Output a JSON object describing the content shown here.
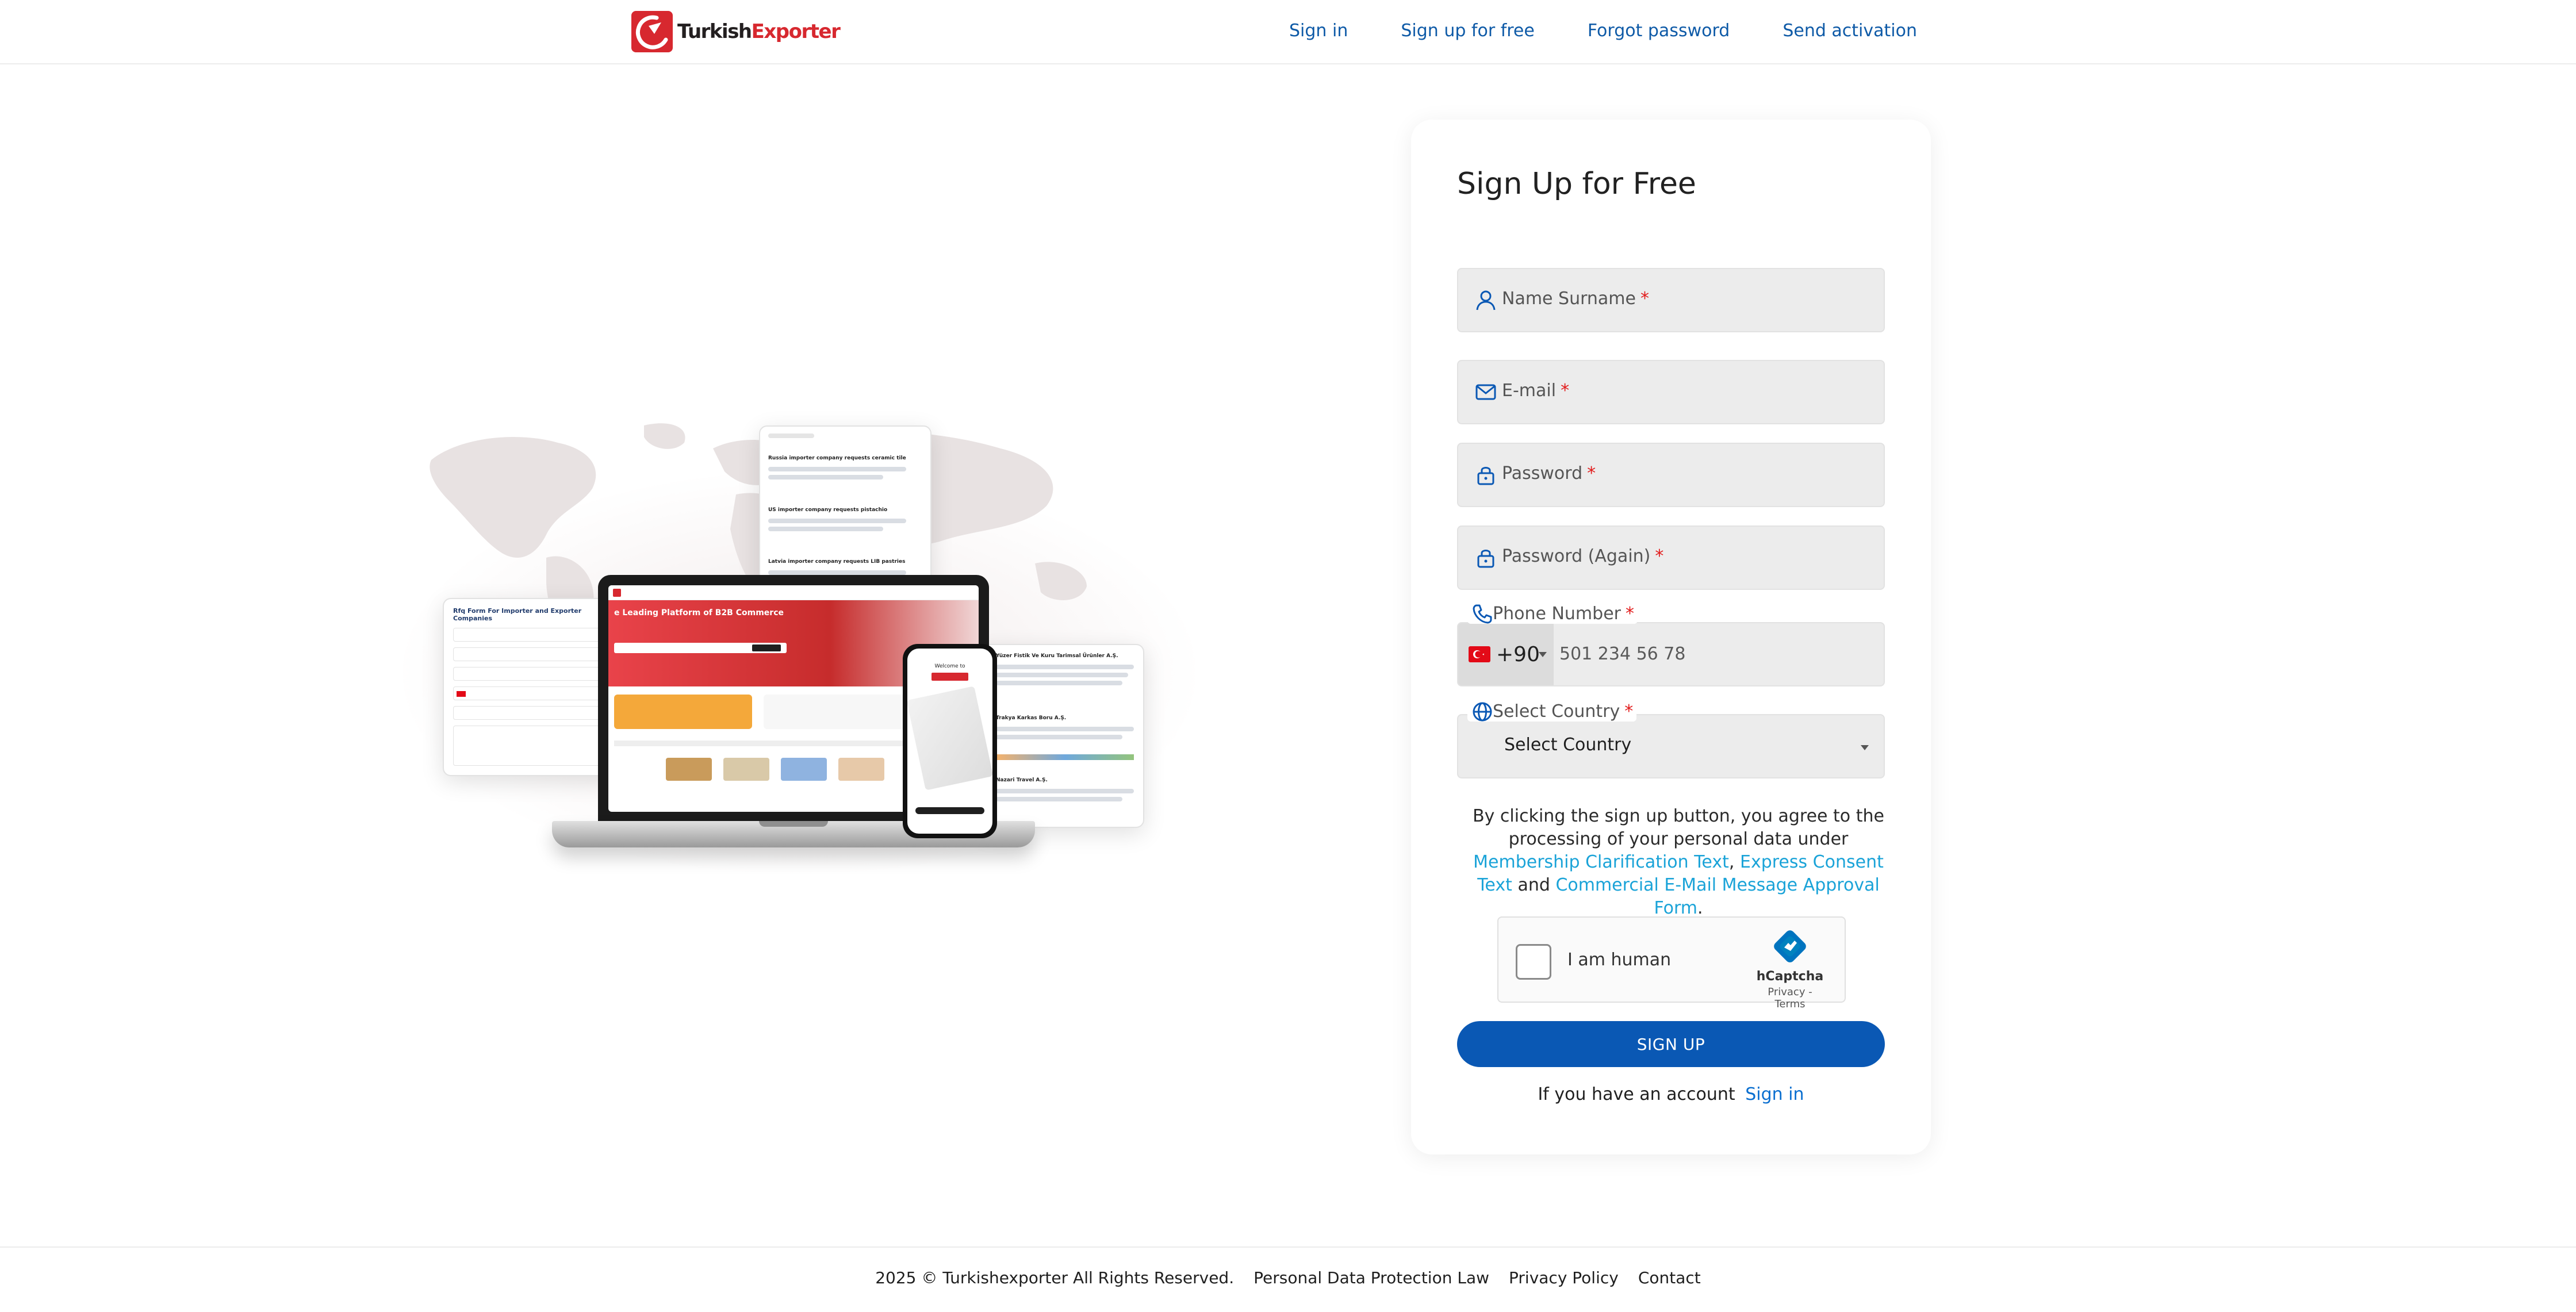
{
  "brand": {
    "name_part1": "Turkish",
    "name_part2": "Exporter",
    "accent": "#d7282f"
  },
  "nav": {
    "items": [
      {
        "label": "Sign in"
      },
      {
        "label": "Sign up for free"
      },
      {
        "label": "Forgot password"
      },
      {
        "label": "Send activation"
      }
    ]
  },
  "form": {
    "title": "Sign Up for Free",
    "name_placeholder": "Name Surname",
    "email_placeholder": "E-mail",
    "password_placeholder": "Password",
    "password_again_placeholder": "Password (Again)",
    "required_mark": "*",
    "phone_label": "Phone Number",
    "phone_country_code": "+90",
    "phone_placeholder": "501 234 56 78",
    "country_label": "Select Country",
    "country_value": "Select Country",
    "consent_prefix": "By clicking the sign up button, you agree to the processing of your personal data under",
    "consent_link1": "Membership Clarification Text",
    "consent_sep": ",",
    "consent_link2": "Express Consent Text",
    "consent_and": "and",
    "consent_link3": "Commercial E-Mail Message Approval Form",
    "consent_end": ".",
    "captcha_label": "I am human",
    "captcha_brand": "hCaptcha",
    "captcha_links": "Privacy - Terms",
    "submit_label": "SIGN UP",
    "have_account": "If you have an account",
    "signin_link": "Sign in",
    "submit_color": "#0a58b4"
  },
  "footer": {
    "copyright": "2025 © Turkishexporter All Rights Reserved.",
    "links": [
      {
        "label": "Personal Data Protection Law"
      },
      {
        "label": "Privacy Policy"
      },
      {
        "label": "Contact"
      }
    ]
  },
  "illustration": {
    "laptop_headline": "e Leading Platform of B2B Commerce",
    "rfq_title": "Rfq Form For Importer and Exporter Companies",
    "phone_welcome": "Welcome to",
    "req1": "Russia importer company requests ceramic tile",
    "req2": "US importer company requests pistachio",
    "req3": "Latvia importer company requests LIB pastries",
    "company1": "Yüzer Fistik Ve Kuru Tarimsal Ürünler A.Ş.",
    "company2": "Trakya Karkas Boru A.Ş.",
    "company3": "Nazari Travel A.Ş."
  }
}
